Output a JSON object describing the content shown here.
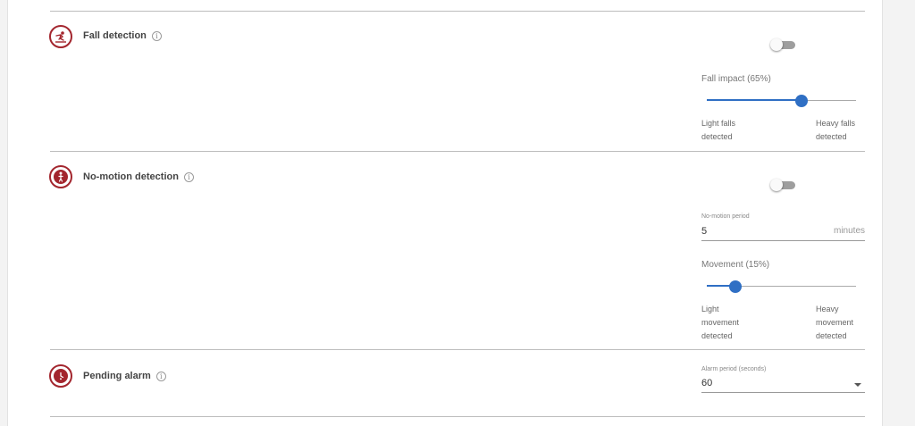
{
  "fall": {
    "title": "Fall detection",
    "toggle_on": false,
    "slider_label": "Fall impact (65%)",
    "slider_value_percent": 65,
    "min_label_1": "Light falls",
    "min_label_2": "detected",
    "max_label_1": "Heavy falls",
    "max_label_2": "detected"
  },
  "nomotion": {
    "title": "No-motion detection",
    "toggle_on": false,
    "period_label": "No-motion period",
    "period_value": "5",
    "period_unit": "minutes",
    "slider_label": "Movement (15%)",
    "slider_value_percent": 15,
    "min_label_1": "Light",
    "min_label_2": "movement",
    "min_label_3": "detected",
    "max_label_1": "Heavy",
    "max_label_2": "movement",
    "max_label_3": "detected"
  },
  "pending": {
    "title": "Pending alarm",
    "alarm_label": "Alarm period (seconds)",
    "alarm_value": "60"
  },
  "icons": {
    "info": "i"
  },
  "colors": {
    "accent_red": "#a3262e",
    "slider_blue": "#2f6fc4"
  }
}
